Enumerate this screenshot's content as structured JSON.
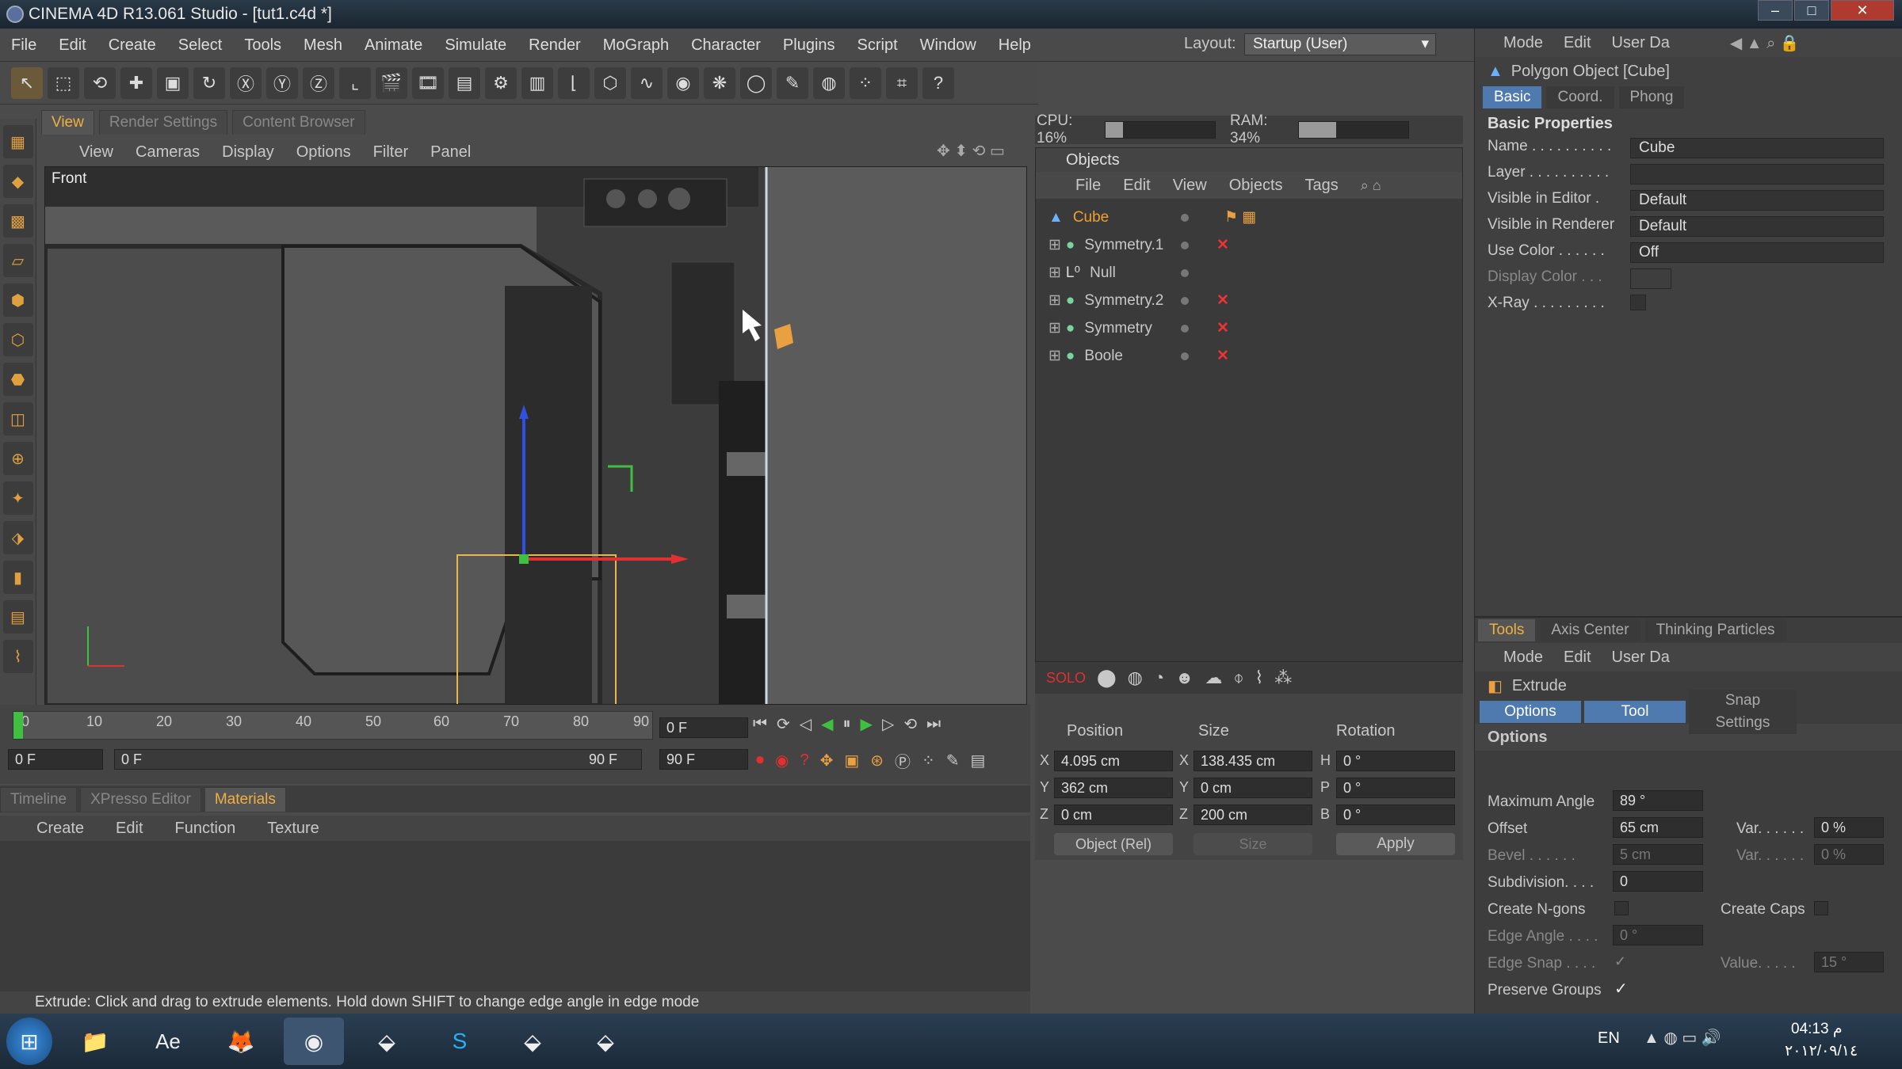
{
  "window": {
    "title": "CINEMA 4D R13.061 Studio - [tut1.c4d *]"
  },
  "menubar": [
    "File",
    "Edit",
    "Create",
    "Select",
    "Tools",
    "Mesh",
    "Animate",
    "Simulate",
    "Render",
    "MoGraph",
    "Character",
    "Plugins",
    "Script",
    "Window",
    "Help"
  ],
  "layout": {
    "label": "Layout:",
    "value": "Startup (User)"
  },
  "viewport": {
    "tabs": [
      "View",
      "Render Settings",
      "Content Browser"
    ],
    "menu": [
      "View",
      "Cameras",
      "Display",
      "Options",
      "Filter",
      "Panel"
    ],
    "label": "Front"
  },
  "timeline": {
    "ticks": [
      "0",
      "10",
      "20",
      "30",
      "40",
      "50",
      "60",
      "70",
      "80",
      "90"
    ],
    "current_frame": "0 F",
    "start": "0 F",
    "range_start": "0 F",
    "range_end": "90 F",
    "end": "90 F"
  },
  "bottom": {
    "tabs": [
      "Timeline",
      "XPresso Editor",
      "Materials"
    ],
    "menu": [
      "Create",
      "Edit",
      "Function",
      "Texture"
    ]
  },
  "status": "Extrude: Click and drag to extrude elements. Hold down SHIFT to change edge angle in edge mode",
  "meters": {
    "cpu_label": "CPU: 16%",
    "cpu": 0.16,
    "ram_label": "RAM: 34%",
    "ram": 0.34
  },
  "objects": {
    "title": "Objects",
    "menu": [
      "File",
      "Edit",
      "View",
      "Objects",
      "Tags"
    ],
    "items": [
      {
        "name": "Cube",
        "x": false
      },
      {
        "name": "Symmetry.1",
        "x": true
      },
      {
        "name": "Null",
        "x": false
      },
      {
        "name": "Symmetry.2",
        "x": true
      },
      {
        "name": "Symmetry",
        "x": true
      },
      {
        "name": "Boole",
        "x": true
      }
    ]
  },
  "coords": {
    "headers": [
      "Position",
      "Size",
      "Rotation"
    ],
    "pos": {
      "x": "4.095 cm",
      "y": "362 cm",
      "z": "0 cm"
    },
    "size": {
      "x": "138.435 cm",
      "y": "0 cm",
      "z": "200 cm"
    },
    "rot": {
      "h": "0 °",
      "p": "0 °",
      "b": "0 °"
    },
    "mode": "Object (Rel)",
    "size_mode": "Size",
    "apply": "Apply"
  },
  "attributes": {
    "menu": [
      "Mode",
      "Edit",
      "User Da"
    ],
    "object_title": "Polygon Object [Cube]",
    "tabs": [
      "Basic",
      "Coord.",
      "Phong"
    ],
    "section": "Basic Properties",
    "props": [
      {
        "label": "Name . . . . . . . . . .",
        "value": "Cube"
      },
      {
        "label": "Layer . . . . . . . . . .",
        "value": ""
      },
      {
        "label": "Visible in Editor .",
        "value": "Default"
      },
      {
        "label": "Visible in Renderer",
        "value": "Default"
      },
      {
        "label": "Use Color . . . . . .",
        "value": "Off"
      },
      {
        "label": "Display Color . . .",
        "value": ""
      },
      {
        "label": "X-Ray . . . . . . . . .",
        "value": ""
      }
    ]
  },
  "tools": {
    "tabs": [
      "Tools",
      "Axis Center",
      "Thinking Particles"
    ],
    "menu": [
      "Mode",
      "Edit",
      "User Da"
    ],
    "tool_title": "Extrude",
    "subtabs": [
      "Options",
      "Tool",
      "Snap Settings"
    ],
    "section": "Options",
    "max_angle_label": "Maximum Angle",
    "max_angle": "89 °",
    "offset_label": "Offset",
    "offset": "65 cm",
    "var_label": "Var. . . . . .",
    "var1": "0 %",
    "bevel_label": "Bevel . . . . . .",
    "bevel": "5 cm",
    "var2": "0 %",
    "subdiv_label": "Subdivision. . . .",
    "subdiv": "0",
    "ngons_label": "Create N-gons",
    "caps_label": "Create Caps",
    "edge_angle_label": "Edge Angle . . . .",
    "edge_angle": "0 °",
    "edge_snap_label": "Edge Snap . . . .",
    "value_label": "Value. . . . .",
    "value": "15 °",
    "preserve_label": "Preserve Groups"
  },
  "taskbar": {
    "lang": "EN",
    "time": "04:13 م",
    "date": "٢٠١٢/٠٩/١٤"
  }
}
